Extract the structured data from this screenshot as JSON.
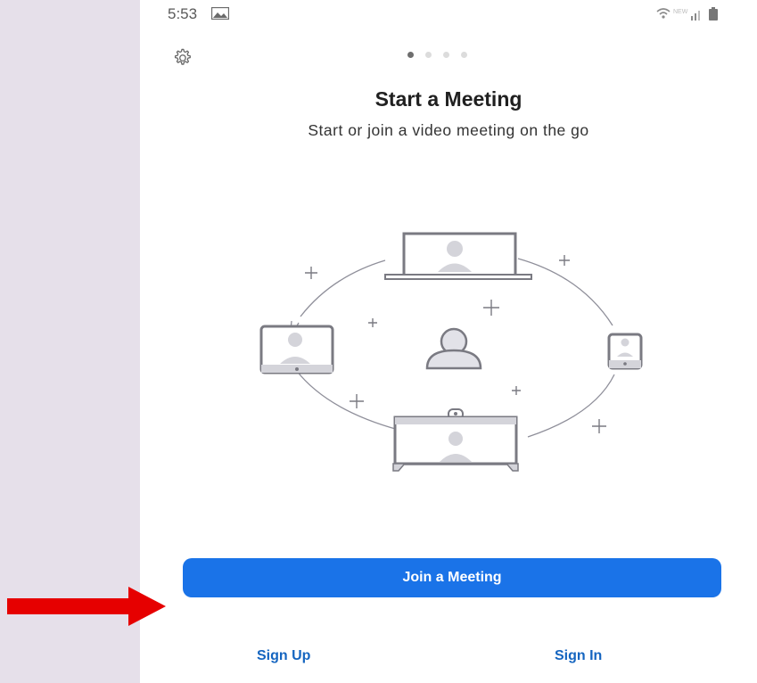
{
  "status_bar": {
    "time": "5:53",
    "image_icon": "image-icon",
    "wifi_icon": "wifi-icon",
    "network_label": "NEW",
    "signal_icon": "signal-icon",
    "battery_icon": "battery-icon"
  },
  "header": {
    "settings_icon": "gear-icon",
    "page_indicator": {
      "total": 4,
      "active_index": 0
    }
  },
  "onboarding": {
    "title": "Start a Meeting",
    "subtitle": "Start or join a video meeting on the go",
    "illustration": "devices-meeting-illustration"
  },
  "actions": {
    "join_label": "Join a Meeting",
    "sign_up_label": "Sign Up",
    "sign_in_label": "Sign In"
  },
  "annotation": {
    "arrow_icon": "red-arrow-icon",
    "arrow_color": "#e60000"
  },
  "colors": {
    "primary_button": "#1a73e8",
    "link": "#1565c0",
    "side_panel": "#e6e0ea"
  }
}
